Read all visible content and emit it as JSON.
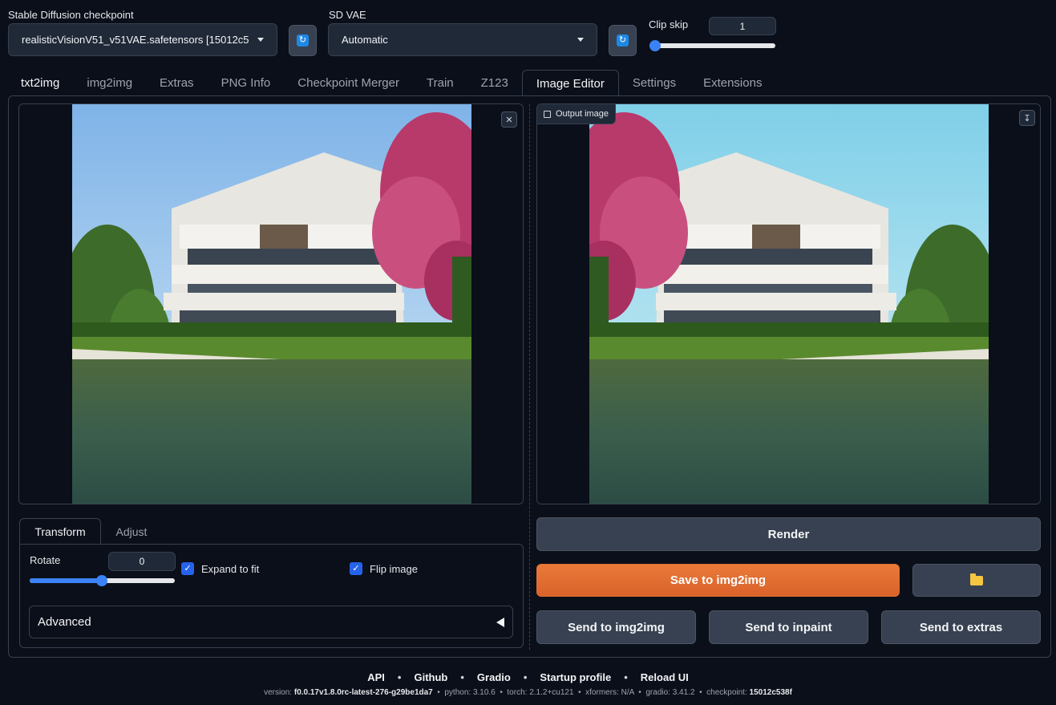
{
  "top": {
    "checkpoint": {
      "label": "Stable Diffusion checkpoint",
      "value": "realisticVisionV51_v51VAE.safetensors [15012c5"
    },
    "vae": {
      "label": "SD VAE",
      "value": "Automatic"
    },
    "clip_skip": {
      "label": "Clip skip",
      "value": "1",
      "slider_fraction": 0.0
    },
    "refresh_icon": "refresh-icon"
  },
  "tabs": [
    {
      "label": "txt2img"
    },
    {
      "label": "img2img"
    },
    {
      "label": "Extras"
    },
    {
      "label": "PNG Info"
    },
    {
      "label": "Checkpoint Merger"
    },
    {
      "label": "Train"
    },
    {
      "label": "Z123"
    },
    {
      "label": "Image Editor",
      "selected": true
    },
    {
      "label": "Settings"
    },
    {
      "label": "Extensions"
    }
  ],
  "editor": {
    "output_label": "Output image",
    "subtabs": [
      {
        "label": "Transform",
        "selected": true
      },
      {
        "label": "Adjust"
      }
    ],
    "rotate": {
      "label": "Rotate",
      "value": "0",
      "slider_fraction": 0.5
    },
    "expand_to_fit": {
      "label": "Expand to fit",
      "checked": true
    },
    "flip_image": {
      "label": "Flip image",
      "checked": true
    },
    "advanced": {
      "label": "Advanced"
    },
    "buttons": {
      "render": "Render",
      "save_to_img2img": "Save to img2img",
      "send_to_img2img": "Send to img2img",
      "send_to_inpaint": "Send to inpaint",
      "send_to_extras": "Send to extras"
    }
  },
  "footer": {
    "links": [
      "API",
      "Github",
      "Gradio",
      "Startup profile",
      "Reload UI"
    ],
    "versions": {
      "version_label": "version:",
      "version": "f0.0.17v1.8.0rc-latest-276-g29be1da7",
      "python_label": "python:",
      "python": "3.10.6",
      "torch_label": "torch:",
      "torch": "2.1.2+cu121",
      "xformers_label": "xformers:",
      "xformers": "N/A",
      "gradio_label": "gradio:",
      "gradio": "3.41.2",
      "checkpoint_label": "checkpoint:",
      "checkpoint": "15012c538f"
    }
  },
  "colors": {
    "accent": "#3b82f6",
    "primary_button": "#e4702f",
    "background": "#0b0f19"
  }
}
